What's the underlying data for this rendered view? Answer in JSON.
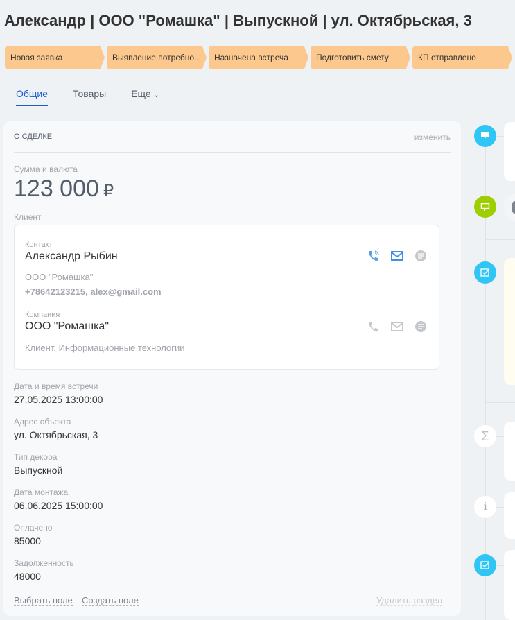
{
  "header": {
    "title": "Александр | ООО \"Ромашка\" | Выпускной | ул. Октябрьская, 3"
  },
  "stages": [
    "Новая заявка",
    "Выявление потребно...",
    "Назначена встреча",
    "Подготовить смету",
    "КП отправлено"
  ],
  "tabs": [
    {
      "label": "Общие"
    },
    {
      "label": "Товары"
    },
    {
      "label": "Еще"
    }
  ],
  "deal": {
    "section_title": "О СДЕЛКЕ",
    "edit_label": "изменить",
    "amount_label": "Сумма и валюта",
    "amount": "123 000",
    "currency": "₽",
    "client_label": "Клиент",
    "contact": {
      "label": "Контакт",
      "name": "Александр Рыбин",
      "company": "ООО \"Ромашка\"",
      "details": "+78642123215, alex@gmail.com"
    },
    "company": {
      "label": "Компания",
      "name": "ООО \"Ромашка\"",
      "details": "Клиент, Информационные технологии"
    },
    "fields": [
      {
        "label": "Дата и время встречи",
        "value": "27.05.2025 13:00:00"
      },
      {
        "label": "Адрес объекта",
        "value": "ул. Октябрьская, 3"
      },
      {
        "label": "Тип декора",
        "value": "Выпускной"
      },
      {
        "label": "Дата монтажа",
        "value": "06.06.2025 15:00:00"
      },
      {
        "label": "Оплачено",
        "value": "85000"
      },
      {
        "label": "Задолженность",
        "value": "48000"
      }
    ],
    "select_field": "Выбрать поле",
    "create_field": "Создать поле",
    "delete_section": "Удалить раздел"
  },
  "colors": {
    "stage": "#fdc88d",
    "accent": "#1b5bd6",
    "blue_dot": "#2fc6f6",
    "green_dot": "#9dcf00"
  }
}
